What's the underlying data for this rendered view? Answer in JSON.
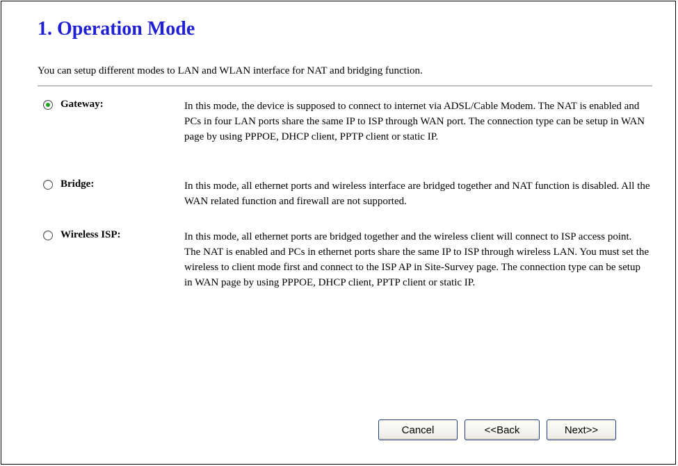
{
  "page": {
    "title": "1. Operation Mode",
    "subtitle": "You can setup different modes to LAN and WLAN interface for NAT and bridging function."
  },
  "modes": [
    {
      "label": "Gateway:",
      "selected": true,
      "description": "In this mode, the device is supposed to connect to internet via ADSL/Cable Modem. The NAT is enabled and PCs in four LAN ports share the same IP to ISP through WAN port. The connection type can be setup in WAN page by using PPPOE, DHCP client, PPTP client or static IP."
    },
    {
      "label": "Bridge:",
      "selected": false,
      "description": "In this mode, all ethernet ports and wireless interface are bridged together and NAT function is disabled. All the WAN related function and firewall are not supported."
    },
    {
      "label": "Wireless ISP:",
      "selected": false,
      "description": "In this mode, all ethernet ports are bridged together and the wireless client will connect to ISP access point. The NAT is enabled and PCs in ethernet ports share the same IP to ISP through wireless LAN. You must set the wireless to client mode first and connect to the ISP AP in Site-Survey page. The connection type can be setup in WAN page by using PPPOE, DHCP client, PPTP client or static IP."
    }
  ],
  "buttons": {
    "cancel": "Cancel",
    "back": "<<Back",
    "next": "Next>>"
  },
  "colors": {
    "title": "#1f1fd4",
    "radio_selected": "#21a121",
    "button_border": "#1c3e7a"
  }
}
